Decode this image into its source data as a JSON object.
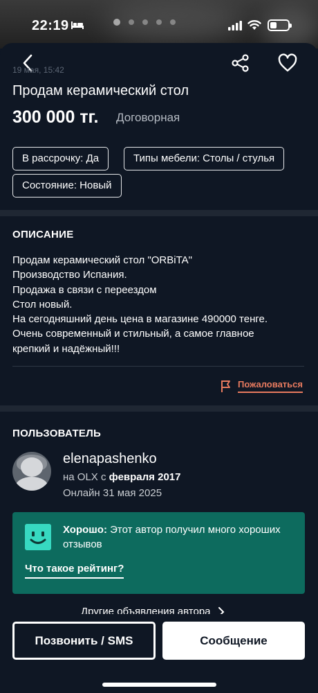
{
  "status_bar": {
    "time": "22:19"
  },
  "listing": {
    "date": "19 мая, 15:42",
    "title": "Продам керамический стол",
    "price": "300 000 тг.",
    "negotiable": "Договорная",
    "params": [
      "В рассрочку: Да",
      "Типы мебели: Столы / стулья",
      "Состояние: Новый"
    ]
  },
  "description": {
    "heading": "ОПИСАНИЕ",
    "lines": [
      "Продам керамический стол \"ORBiTA\"",
      "Производство Испания.",
      "Продажа в связи с переездом",
      "Стол новый.",
      "На сегодняшний день цена в магазине 490000 тенге.",
      "Очень современный и стильный, а самое главное",
      "крепкий и надёжный!!!"
    ],
    "report_label": "Пожаловаться"
  },
  "user": {
    "heading": "ПОЛЬЗОВАТЕЛЬ",
    "name": "elenapashenko",
    "since_prefix": "на OLX с ",
    "since_date": "февраля 2017",
    "online": "Онлайн 31 мая 2025",
    "rating": {
      "label": "Хорошо:",
      "text": " Этот автор получил много хороших отзывов",
      "link": "Что такое рейтинг?"
    },
    "other_ads": "Другие объявления автора"
  },
  "actions": {
    "call": "Позвонить / SMS",
    "message": "Сообщение"
  },
  "colors": {
    "background": "#0f1724",
    "accent_report": "#e97b5f",
    "rating_card": "#0d6b5e",
    "rating_face": "#37d9c1"
  }
}
